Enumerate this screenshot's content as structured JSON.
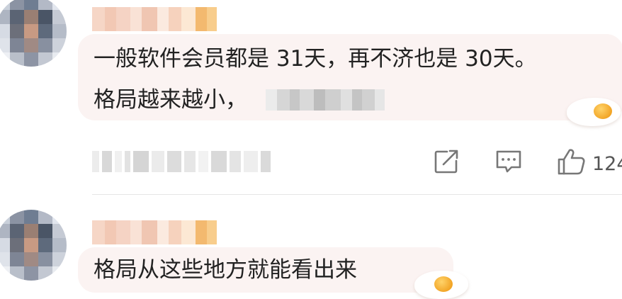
{
  "comments": [
    {
      "avatar_colors": [
        "#c9d0da",
        "#8b93a3",
        "#6f7d92",
        "#b3b9c6",
        "#e2e6ee",
        "#aeb5c2",
        "#5b6474",
        "#9a7f73",
        "#4a5566",
        "#c5cad4",
        "#d6dbe4",
        "#6c6f7a",
        "#c89a83",
        "#5e6a7c",
        "#b5bcc8",
        "#dfe3ea",
        "#7e8595",
        "#a08a84",
        "#8890a0",
        "#cdd2db",
        "#eef0f4",
        "#b9bfca",
        "#8d94a4",
        "#c3c8d2",
        "#e8ebf0"
      ],
      "name_colors": [
        "#f6d6c6",
        "#f2c8b4",
        "#f5d3c4",
        "#f9e2d6",
        "#f0c6b2",
        "#fbeadf",
        "#f6d2bd",
        "#fce8d4",
        "#f3b96f",
        "#f8cd8c"
      ],
      "text_line1": "一般软件会员都是 31天，再不济也是 30天。",
      "text_line2": "格局越来越小，",
      "inline_blur_colors": [
        "#ebebeb",
        "#d6d6d6",
        "#c7c7c7",
        "#d9d9d9",
        "#bdbdbd",
        "#cfcfcf",
        "#e0e0e0",
        "#c4c4c4",
        "#d1d1d1",
        "#e6e6e6"
      ],
      "meta_blur_colors": [
        "#ececec",
        "#d8d8d8",
        "#f0f0f0",
        "#e2e2e2",
        "#d5d5d5",
        "#ebebeb",
        "#dcdcdc",
        "#e6e6e6",
        "#f2f2f2",
        "#d9d9d9",
        "#e4e4e4",
        "#eeeeee",
        "#dadada"
      ],
      "like_count": "124"
    },
    {
      "avatar_colors": [
        "#c9d0da",
        "#8b93a3",
        "#6f7d92",
        "#b3b9c6",
        "#e2e6ee",
        "#aeb5c2",
        "#5b6474",
        "#9a7f73",
        "#4a5566",
        "#c5cad4",
        "#d6dbe4",
        "#6c6f7a",
        "#c89a83",
        "#5e6a7c",
        "#b5bcc8",
        "#dfe3ea",
        "#7e8595",
        "#a08a84",
        "#8890a0",
        "#cdd2db",
        "#eef0f4",
        "#b9bfca",
        "#8d94a4",
        "#c3c8d2",
        "#e8ebf0"
      ],
      "name_colors": [
        "#f6d6c6",
        "#f2c8b4",
        "#f5d3c4",
        "#f9e2d6",
        "#f0c6b2",
        "#fbeadf",
        "#f6d2bd",
        "#fce8d4",
        "#f3b96f",
        "#f8cd8c"
      ],
      "text_line1": "格局从这些地方就能看出来"
    }
  ],
  "icons": {
    "share": "share-icon",
    "comment": "comment-icon",
    "like": "thumbs-up-icon"
  },
  "colors": {
    "bubble_bg": "#fbf3f2",
    "icon_stroke": "#777777",
    "divider": "#e6e6e6"
  }
}
